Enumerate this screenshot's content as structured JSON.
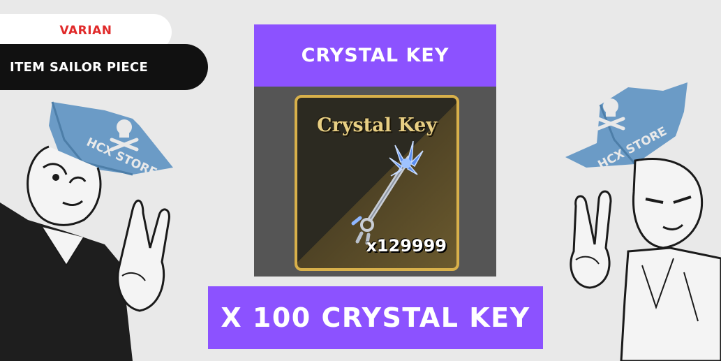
{
  "tags": {
    "variant_label": "VARIAN",
    "item_label": "ITEM SAILOR PIECE"
  },
  "card": {
    "title": "CRYSTAL KEY",
    "item_name": "Crystal Key",
    "item_count": "x129999"
  },
  "offer": {
    "label": "X 100 CRYSTAL KEY"
  },
  "watermark": {
    "left_hat_text": "HCX STORE",
    "right_hat_text": "HCX STORE"
  },
  "colors": {
    "accent_purple": "#8c52ff",
    "variant_red": "#e02a2a",
    "frame_gold": "#d8b04a",
    "hat_blue": "#6b9bc6"
  }
}
